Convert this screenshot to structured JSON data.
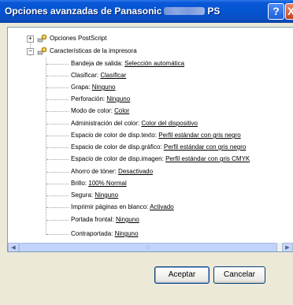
{
  "window": {
    "title_start": "Opciones avanzadas de Panasonic",
    "title_end": "PS",
    "help_label": "?",
    "close_label": "X"
  },
  "tree": {
    "root_items": [
      {
        "label": "Opciones PostScript",
        "expanded": false
      },
      {
        "label": "Características de la impresora",
        "expanded": true
      }
    ],
    "settings": [
      {
        "label": "Bandeja de salida:",
        "value": "Selección automática"
      },
      {
        "label": "Clasificar:",
        "value": "Clasificar"
      },
      {
        "label": "Grapa:",
        "value": "Ninguno"
      },
      {
        "label": "Perforación:",
        "value": "Ninguno"
      },
      {
        "label": "Modo de color:",
        "value": "Color"
      },
      {
        "label": "Administración del color:",
        "value": "Color del dispositivo"
      },
      {
        "label": "Espacio de color de disp.texto:",
        "value": "Perfil estándar con gris negro"
      },
      {
        "label": "Espacio de color de disp.gráfico:",
        "value": "Perfil estándar con gris negro"
      },
      {
        "label": "Espacio de color de disp.imagen:",
        "value": "Perfil estándar con gris CMYK"
      },
      {
        "label": "Ahorro de tóner:",
        "value": "Desactivado"
      },
      {
        "label": "Brillo:",
        "value": "100% Normal"
      },
      {
        "label": "Segura:",
        "value": "Ninguno"
      },
      {
        "label": "Imprimir páginas en blanco:",
        "value": "Activado"
      },
      {
        "label": "Portada frontal:",
        "value": "Ninguno"
      },
      {
        "label": "Contraportada:",
        "value": "Ninguno"
      }
    ]
  },
  "buttons": {
    "ok": "Aceptar",
    "cancel": "Cancelar"
  },
  "colors": {
    "titlebar": "#0453cf",
    "dialog_bg": "#ece9d8",
    "tree_border": "#7f9db9"
  }
}
